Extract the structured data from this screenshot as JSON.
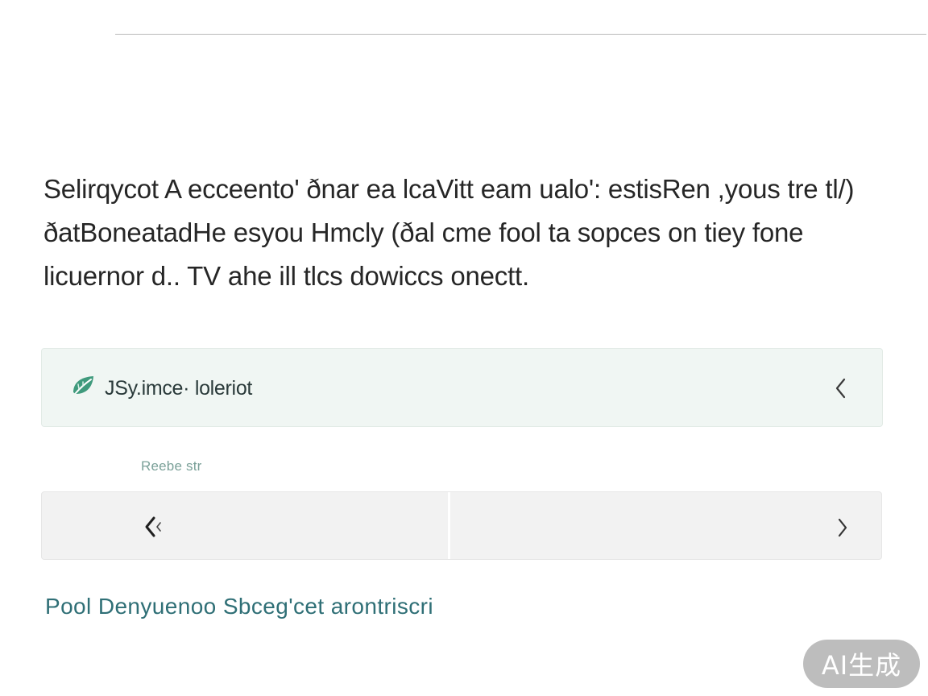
{
  "intro": {
    "text": "Selirqycot A ecceento' ðnar ea lcaVitt eam ualo': estisRen ,yous tre tl/) ðatBoneatadHe esyou Hmcly (ðal cme fool ta sopces on tiey fone licuernor d.. TV ahe ill tlcs dowiccs onectt."
  },
  "option_card": {
    "icon": "leaf-icon",
    "label": "JSy.imce· loleriot",
    "chevron": "chevron-left-icon",
    "accent_color": "#3f9a7c",
    "background": "#f0f6f3"
  },
  "caption": {
    "text": "Reebe str"
  },
  "pager": {
    "prev_icon": "double-chevron-left-icon",
    "next_icon": "chevron-right-icon"
  },
  "footer": {
    "link_text": "Pool Denyuenoo Sbceg'cet arontriscri",
    "color": "#2f6f76"
  },
  "badge": {
    "text": "AI生成"
  }
}
